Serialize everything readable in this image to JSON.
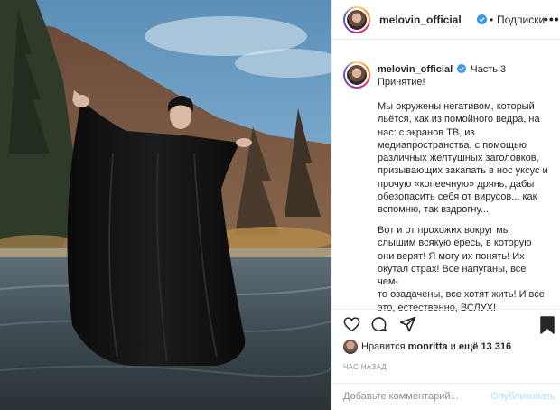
{
  "post": {
    "author": "melovin_official",
    "follow_separator": "•",
    "follow_label": "Подписки",
    "more_label": "•••",
    "caption_title": "Часть 3",
    "caption_subtitle": "Принятие!",
    "caption_paragraph_1": "Мы окружены негативом, который\nльётся, как из помойного ведра, на\nнас: с экранов ТВ, из\nмедиапространства, с помощью\nразличных желтушных заголовков,\nпризывающих закапать в нос уксус и\nпрочую «копеечную» дрянь, дабы\nобезопасить себя от вирусов... как\nвспомню, так вздрогну...",
    "caption_paragraph_2": "Вот и от прохожих вокруг мы\nслышим всякую ересь, в которую\nони верят! Я могу их понять! Их\nокутал страх! Все напуганы, все чем-\nто озадачены, все хотят жить! И все\nэто, естественно, ВСЛУХ!",
    "likes_prefix": "Нравится ",
    "likes_user": "monritta",
    "likes_middle": " и ",
    "likes_count": "ещё 13 316",
    "timestamp": "ЧАС НАЗАД"
  },
  "comment": {
    "placeholder": "Добавьте комментарий...",
    "publish_label": "Опубликовать"
  },
  "icons": {
    "verified": "verified-badge-icon",
    "like": "heart-icon",
    "comment": "comment-bubble-icon",
    "share": "paper-plane-icon",
    "save": "bookmark-icon",
    "more": "more-options-icon"
  },
  "colors": {
    "verified_blue": "#3897f0",
    "publish_disabled": "#b2dffc",
    "muted": "#8e8e8e",
    "text": "#262626"
  }
}
